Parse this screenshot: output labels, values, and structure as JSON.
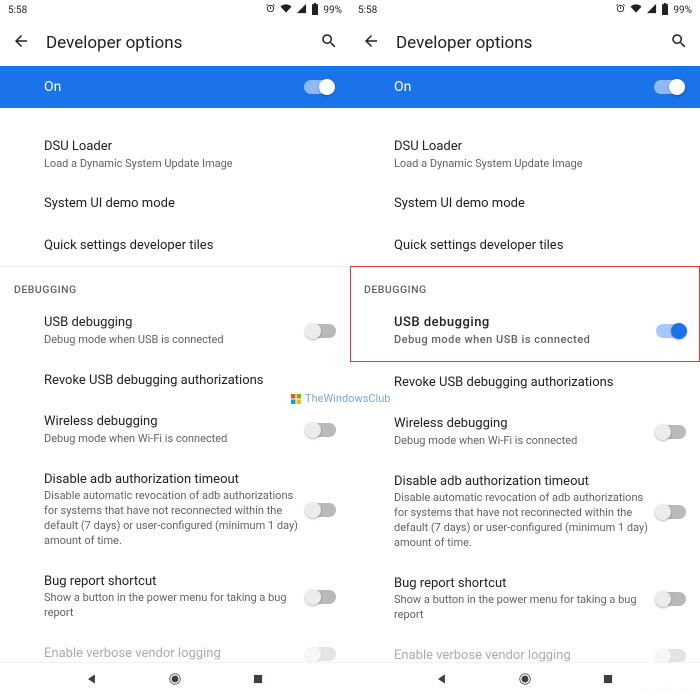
{
  "status": {
    "time": "5:58",
    "battery": "99%"
  },
  "header": {
    "title": "Developer options"
  },
  "banner": {
    "label": "On"
  },
  "items": {
    "dsu_title": "DSU Loader",
    "dsu_desc": "Load a Dynamic System Update Image",
    "sysui": "System UI demo mode",
    "tiles": "Quick settings developer tiles",
    "usb_title": "USB debugging",
    "usb_desc": "Debug mode when USB is connected",
    "revoke": "Revoke USB debugging authorizations",
    "wireless_title": "Wireless debugging",
    "wireless_desc": "Debug mode when Wi-Fi is connected",
    "disable_adb_title": "Disable adb authorization timeout",
    "disable_adb_desc": "Disable automatic revocation of adb authorizations for systems that have not reconnected within the default (7 days) or user-configured (minimum 1 day) amount of time.",
    "bugreport_title": "Bug report shortcut",
    "bugreport_desc": "Show a button in the power menu for taking a bug report",
    "verbose_title": "Enable verbose vendor logging"
  },
  "sections": {
    "debugging": "DEBUGGING"
  },
  "watermark": {
    "text": "TheWindowsClub",
    "site": "wsxdn.com"
  }
}
